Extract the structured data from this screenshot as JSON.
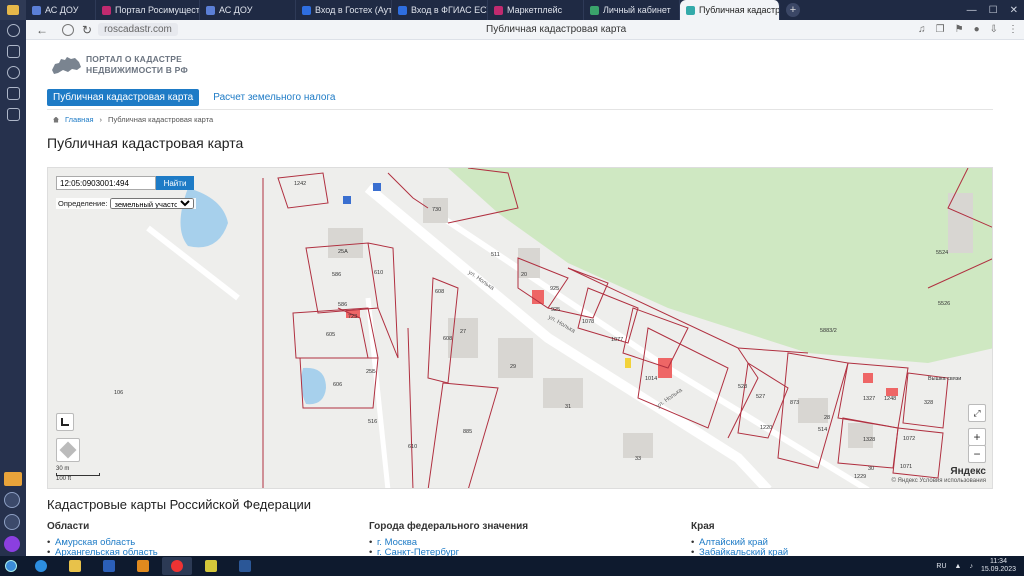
{
  "browser": {
    "tabs": [
      {
        "label": "АС ДОУ"
      },
      {
        "label": "Портал Росимущества"
      },
      {
        "label": "АС ДОУ"
      },
      {
        "label": "Вход в Гостех (Аутентиф"
      },
      {
        "label": "Вход в ФГИАС ЕСУГИ"
      },
      {
        "label": "Маркетплейс"
      },
      {
        "label": "Личный кабинет"
      },
      {
        "label": "Публичная кадастров",
        "active": true
      }
    ],
    "url": "roscadastr.com",
    "page_title": "Публичная кадастровая карта"
  },
  "site": {
    "logo_line1": "ПОРТАЛ О КАДАСТРЕ",
    "logo_line2": "НЕДВИЖИМОСТИ В РФ",
    "nav_tabs": [
      {
        "label": "Публичная кадастровая карта",
        "active": true
      },
      {
        "label": "Расчет земельного налога",
        "active": false
      }
    ],
    "breadcrumb": {
      "home": "Главная",
      "current": "Публичная кадастровая карта"
    },
    "heading": "Публичная кадастровая карта"
  },
  "map": {
    "search_value": "12:05:0903001:494",
    "search_button": "Найти",
    "definition_label": "Определение:",
    "definition_value": "земельный участок",
    "scale_m": "30 m",
    "scale_ft": "100 ft",
    "provider": "Яндекс",
    "copyright": "© Яндекс  Условия использования",
    "zoom_in": "+",
    "zoom_out": "−",
    "parcel_labels": [
      "1242",
      "730",
      "25А",
      "586",
      "610",
      "586",
      "723",
      "605",
      "606",
      "25Б",
      "106",
      "608",
      "27",
      "608",
      "511",
      "20",
      "925",
      "925",
      "1078",
      "1077",
      "1014",
      "29",
      "31",
      "885",
      "33",
      "516",
      "610",
      "5883/2",
      "5524",
      "5526",
      "528",
      "527",
      "873",
      "1220",
      "28",
      "514",
      "1327",
      "1248",
      "328",
      "1328",
      "1072",
      "30",
      "1071",
      "1229",
      "Вышка связи"
    ],
    "street_labels": [
      "ул. Нолька",
      "ул. Нолька",
      "ул. Нолька"
    ]
  },
  "catalog": {
    "heading": "Кадастровые карты Российской Федерации",
    "columns": [
      {
        "title": "Области",
        "items": [
          "Амурская область",
          "Архангельская область"
        ]
      },
      {
        "title": "Города федерального значения",
        "items": [
          "г. Москва",
          "г. Санкт-Петербург"
        ]
      },
      {
        "title": "Края",
        "items": [
          "Алтайский край",
          "Забайкальский край"
        ]
      }
    ]
  },
  "taskbar": {
    "lang": "RU",
    "time": "11:34",
    "date": "15.09.2023"
  }
}
